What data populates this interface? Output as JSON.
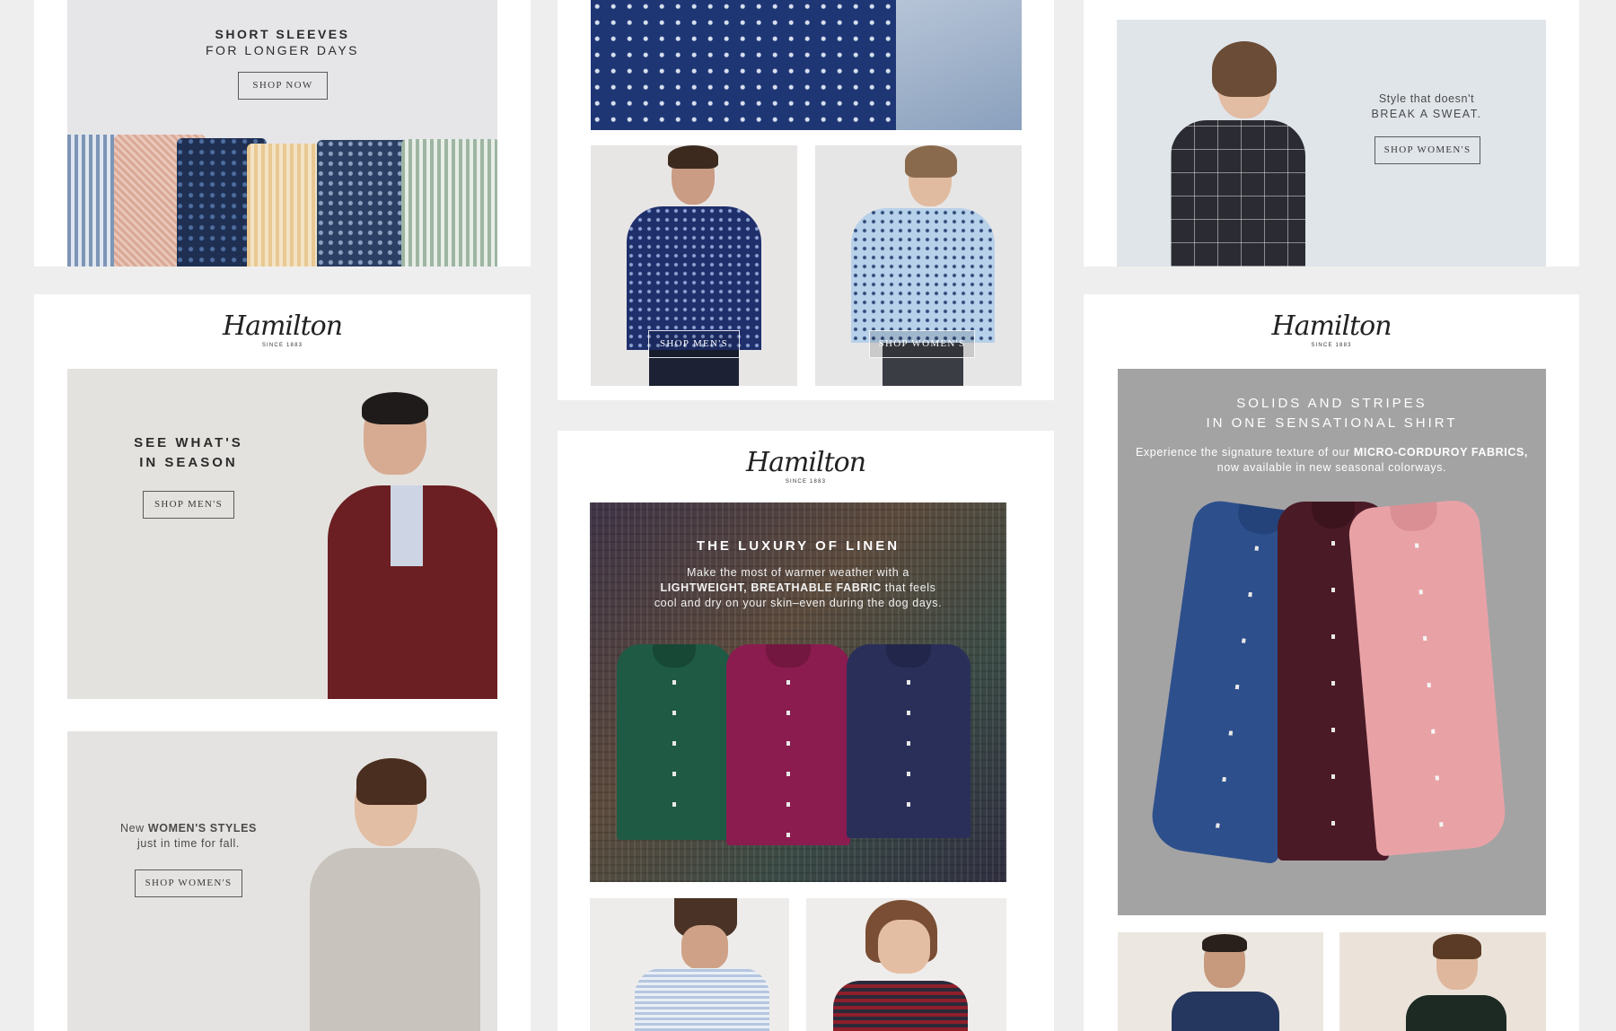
{
  "colors": {
    "page_bg": "#eeeeee",
    "card_bg": "#ffffff",
    "text_dark": "#2b2b2b",
    "linen_green": "#1f5a44",
    "linen_magenta": "#8a1c4f",
    "linen_navy": "#2a2f5a",
    "corduroy_blue": "#2d4f8c",
    "corduroy_burgundy": "#4a1a26",
    "corduroy_pink": "#e8a2a6"
  },
  "logo": {
    "wordmark": "Hamilton",
    "since": "SINCE 1883"
  },
  "card_short_sleeves": {
    "line1": "SHORT SLEEVES",
    "line2": "FOR LONGER DAYS",
    "button": "SHOP NOW"
  },
  "card_print": {
    "shop_mens": "SHOP MEN'S",
    "shop_womens": "SHOP WOMEN'S"
  },
  "card_sweat": {
    "line1": "Style that doesn't",
    "line2": "BREAK A SWEAT.",
    "button": "SHOP WOMEN'S"
  },
  "card_season": {
    "line1": "SEE WHAT'S",
    "line2": "IN SEASON",
    "button": "SHOP MEN'S",
    "line3_pre": "New",
    "line3_bold": "WOMEN'S STYLES",
    "line4": "just in time for fall.",
    "button2": "SHOP WOMEN'S"
  },
  "card_linen": {
    "title": "THE LUXURY OF LINEN",
    "line1": "Make the most of warmer weather with a",
    "line2_bold": "LIGHTWEIGHT, BREATHABLE FABRIC",
    "line2_rest": "that feels",
    "line3": "cool and dry on your skin–even during the dog days."
  },
  "card_corduroy": {
    "title1": "SOLIDS AND STRIPES",
    "title2": "IN ONE SENSATIONAL SHIRT",
    "line1_pre": "Experience the signature texture of our",
    "line1_bold": "MICRO-CORDUROY FABRICS,",
    "line2": "now available in new seasonal colorways."
  }
}
